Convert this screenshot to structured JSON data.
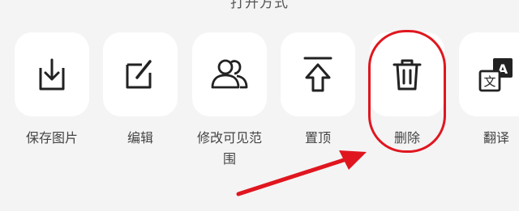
{
  "sheet": {
    "title": "打开方式"
  },
  "actions": [
    {
      "label": "保存图片",
      "icon": "save-image-icon"
    },
    {
      "label": "编辑",
      "icon": "edit-icon"
    },
    {
      "label": "修改可见范围",
      "icon": "visibility-users-icon"
    },
    {
      "label": "置顶",
      "icon": "pin-to-top-icon"
    },
    {
      "label": "删除",
      "icon": "trash-icon"
    },
    {
      "label": "翻译",
      "icon": "translate-icon"
    }
  ],
  "annotation": {
    "highlight_color": "#e0161f",
    "highlighted_action": "删除"
  }
}
